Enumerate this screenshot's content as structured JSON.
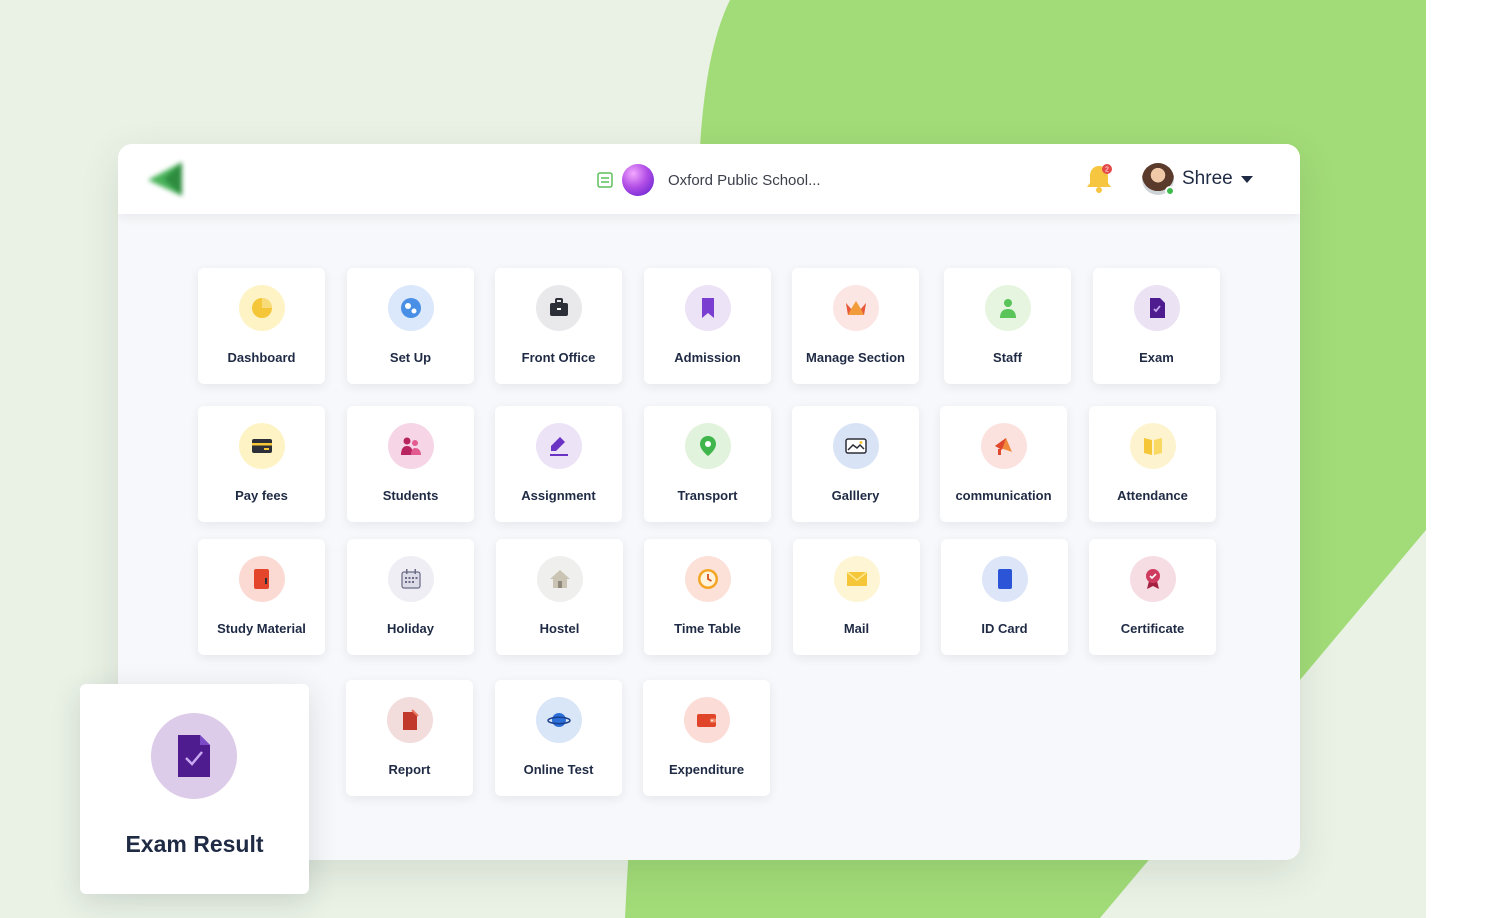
{
  "header": {
    "school_name": "Oxford Public School...",
    "user_name": "Shree",
    "notification_count": "2"
  },
  "modules": [
    {
      "label": "Dashboard"
    },
    {
      "label": "Set Up"
    },
    {
      "label": "Front Office"
    },
    {
      "label": "Admission"
    },
    {
      "label": "Manage Section"
    },
    {
      "label": "Staff"
    },
    {
      "label": "Exam"
    },
    {
      "label": "Pay fees"
    },
    {
      "label": "Students"
    },
    {
      "label": "Assignment"
    },
    {
      "label": "Transport"
    },
    {
      "label": "Galllery"
    },
    {
      "label": "communication"
    },
    {
      "label": "Attendance"
    },
    {
      "label": "Study Material"
    },
    {
      "label": "Holiday"
    },
    {
      "label": "Hostel"
    },
    {
      "label": "Time Table"
    },
    {
      "label": "Mail"
    },
    {
      "label": "ID Card"
    },
    {
      "label": "Certificate"
    },
    {
      "label": "Report"
    },
    {
      "label": "Online Test"
    },
    {
      "label": "Expenditure"
    }
  ],
  "highlight_card": {
    "label": "Exam Result"
  },
  "colors": {
    "accent_green": "#a2dc78",
    "text_navy": "#1f2a44"
  }
}
